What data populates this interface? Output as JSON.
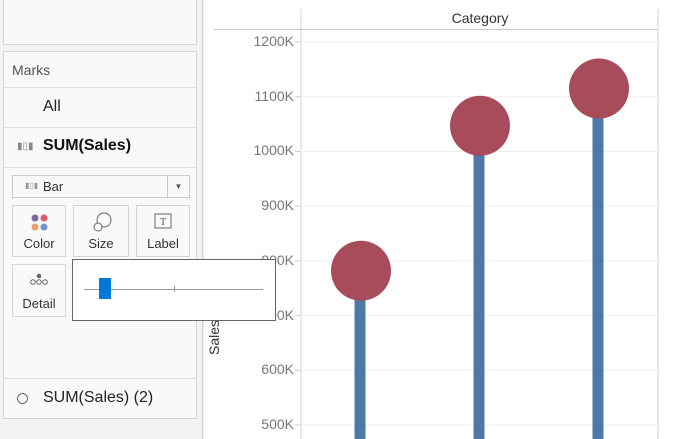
{
  "marks_panel": {
    "title": "Marks",
    "all_label": "All",
    "measure_label": "SUM(Sales)",
    "mark_type": "Bar",
    "buttons": {
      "color": "Color",
      "size": "Size",
      "label": "Label",
      "detail": "Detail"
    },
    "size_slider_value": 0.08,
    "second_measure_label": "SUM(Sales) (2)"
  },
  "colors": {
    "bar": "#4e79a7",
    "circle": "#a84c5b",
    "slider": "#0078d7"
  },
  "chart_data": {
    "type": "bar",
    "title": "Category",
    "ylabel": "Sales",
    "ylim": [
      480,
      1240
    ],
    "yticks": [
      500,
      600,
      700,
      800,
      900,
      1000,
      1100,
      1200
    ],
    "tick_labels": [
      "500K",
      "600K",
      "700K",
      "800K",
      "900K",
      "1000K",
      "1100K",
      "1200K"
    ],
    "series": [
      {
        "name": "SUM(Sales)",
        "mark": "bar",
        "values": [
          782,
          1047,
          1115
        ]
      },
      {
        "name": "SUM(Sales) (2)",
        "mark": "circle",
        "values": [
          782,
          1047,
          1115
        ]
      }
    ]
  }
}
